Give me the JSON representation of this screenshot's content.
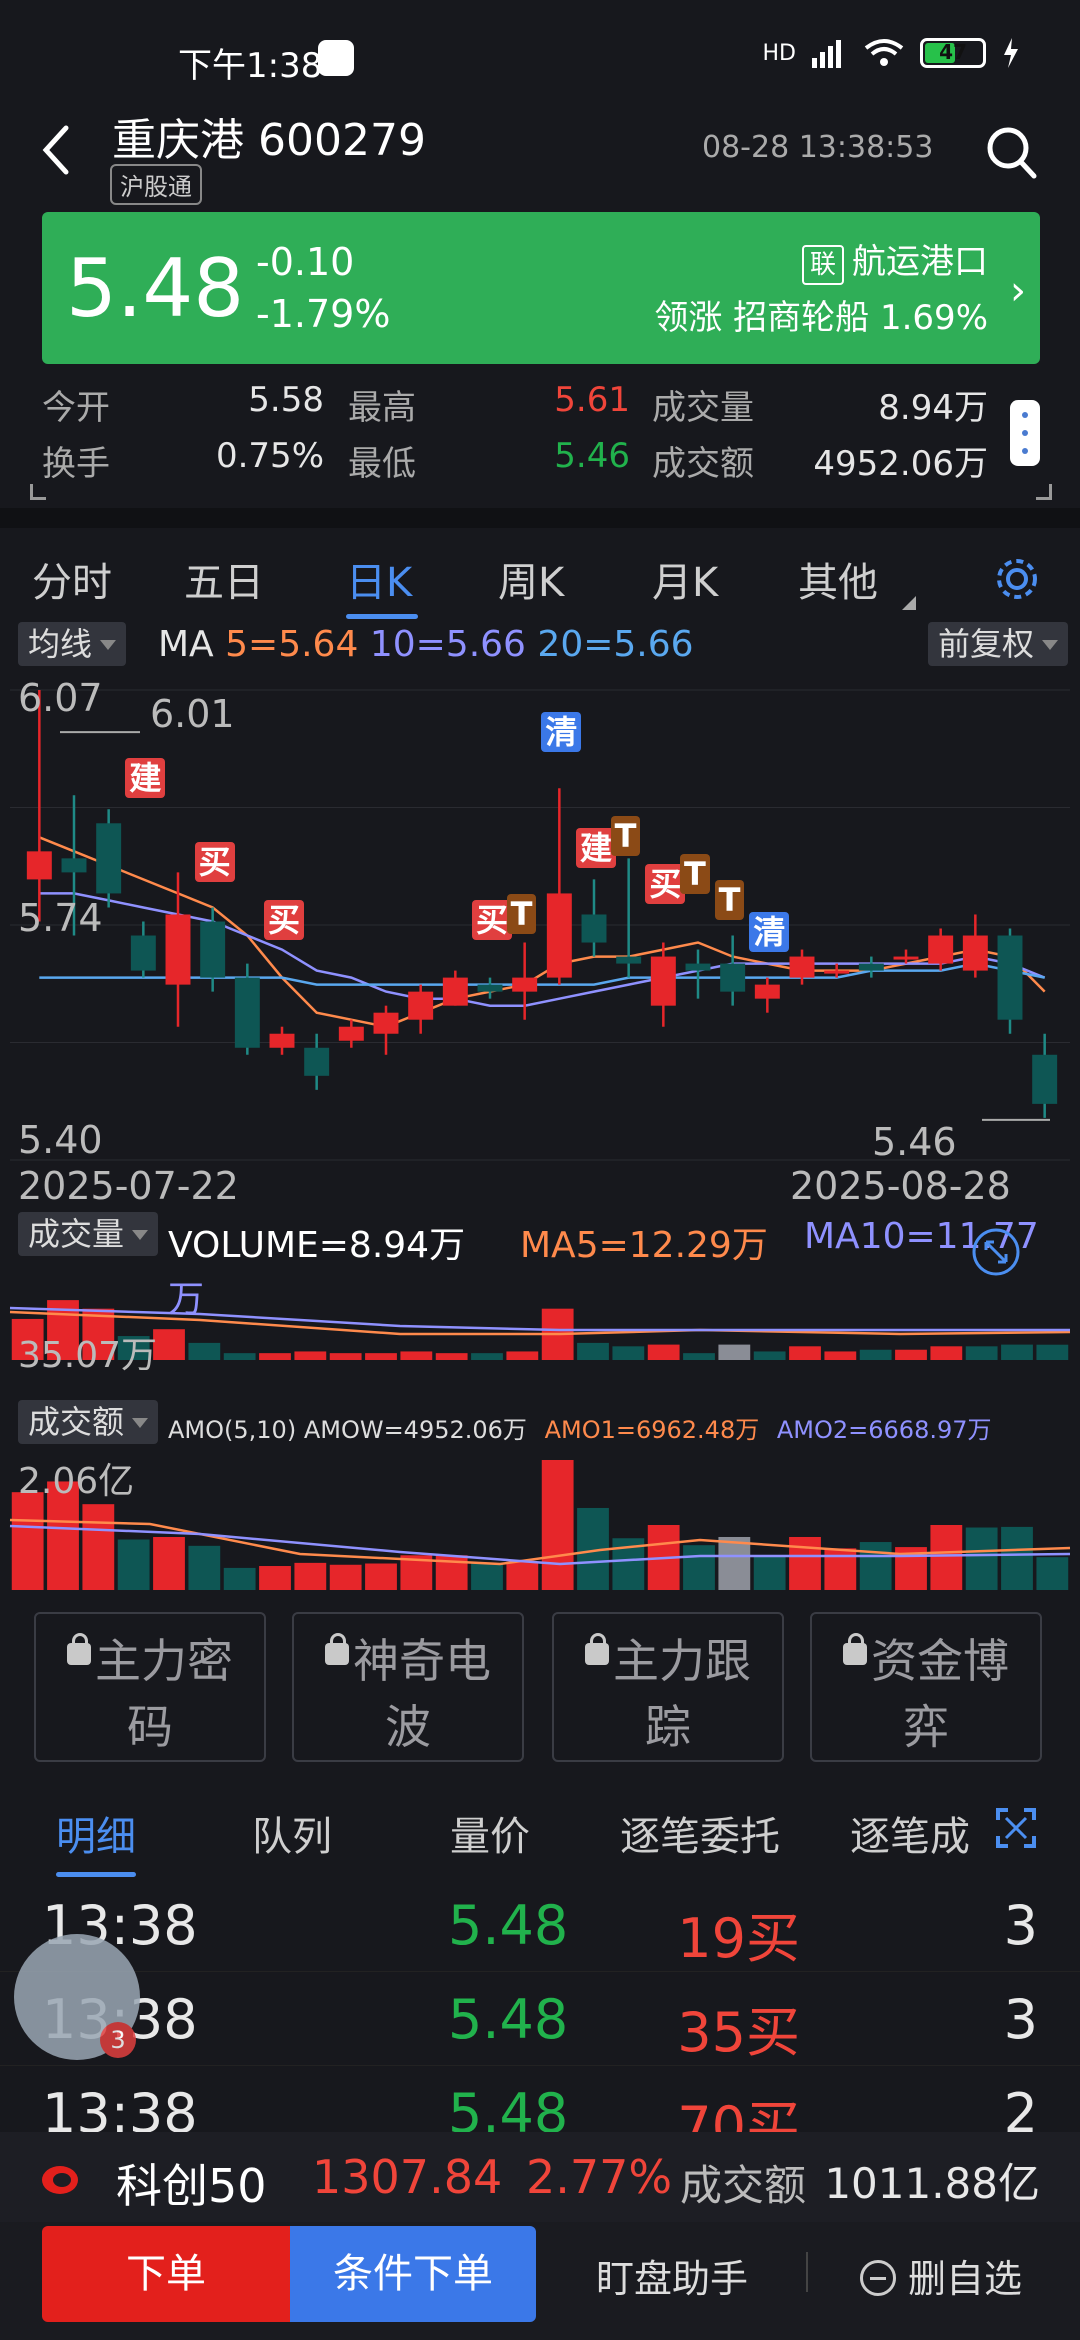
{
  "status": {
    "time": "下午1:38",
    "battery": "47",
    "network": "HD"
  },
  "header": {
    "stock_name": "重庆港 600279",
    "badge": "沪股通",
    "datetime": "08-28 13:38:53"
  },
  "banner": {
    "price": "5.48",
    "change": "-0.10",
    "change_pct": "-1.79%",
    "sector_tag": "联",
    "sector": "航运港口",
    "leader": "领涨 招商轮船 1.69%"
  },
  "stats": [
    {
      "label": "今开",
      "value": "5.58",
      "color": "#e6e6e6"
    },
    {
      "label": "最高",
      "value": "5.61",
      "color": "#f0453a"
    },
    {
      "label": "成交量",
      "value": "8.94万",
      "color": "#e6e6e6"
    },
    {
      "label": "换手",
      "value": "0.75%",
      "color": "#e6e6e6"
    },
    {
      "label": "最低",
      "value": "5.46",
      "color": "#21b24c"
    },
    {
      "label": "成交额",
      "value": "4952.06万",
      "color": "#e6e6e6"
    }
  ],
  "tabs": [
    "分时",
    "五日",
    "日K",
    "周K",
    "月K",
    "其他"
  ],
  "active_tab": "日K",
  "kline": {
    "indicator_pill": "均线",
    "adjust_pill": "前复权",
    "ma_prefix": "MA",
    "ma5": "5=5.64",
    "ma10": "10=5.66",
    "ma20": "20=5.66",
    "axis_high": "6.07",
    "axis_mid": "5.74",
    "axis_low": "5.40",
    "peak_label": "6.01",
    "trough_label": "5.46",
    "date_start": "2025-07-22",
    "date_end": "2025-08-28",
    "signals": [
      "建",
      "买",
      "买",
      "清",
      "建",
      "买",
      "T",
      "T",
      "T",
      "买",
      "T",
      "清"
    ]
  },
  "volume": {
    "pill": "成交量",
    "label": "VOLUME=8.94万",
    "ma5": "MA5=12.29万",
    "ma10": "MA10=11.77",
    "ma10_unit": "万",
    "max": "35.07万"
  },
  "amount": {
    "pill": "成交额",
    "label": "AMO(5,10)",
    "amow": "AMOW=4952.06万",
    "amo1": "AMO1=6962.48万",
    "amo2": "AMO2=6668.97万",
    "max": "2.06亿"
  },
  "tools": [
    {
      "line1": "主力密",
      "line2": "码"
    },
    {
      "line1": "神奇电",
      "line2": "波"
    },
    {
      "line1": "主力跟",
      "line2": "踪"
    },
    {
      "line1": "资金博",
      "line2": "弈"
    }
  ],
  "detail_tabs": [
    "明细",
    "队列",
    "量价",
    "逐笔委托",
    "逐笔成"
  ],
  "trades": [
    {
      "time": "13:38",
      "price": "5.48",
      "qty": "19买",
      "count": "3"
    },
    {
      "time": "13:38",
      "price": "5.48",
      "qty": "35买",
      "count": "3"
    },
    {
      "time": "13:38",
      "price": "5.48",
      "qty": "70买",
      "count": "2"
    }
  ],
  "avatar_badge": "3",
  "ticker": {
    "name": "科创50",
    "value": "1307.84",
    "pct": "2.77%",
    "amount_label": "成交额",
    "amount": "1011.88亿"
  },
  "bottom": {
    "order": "下单",
    "conditional": "条件下单",
    "helper": "盯盘助手",
    "remove": "删自选"
  },
  "colors": {
    "up": "#e6262a",
    "down": "#0e5654",
    "accent": "#4b8ef0",
    "banner": "#2fae57"
  },
  "chart_data": [
    {
      "type": "candlestick",
      "title": "日K",
      "xlabel": "",
      "ylabel": "",
      "x_range": [
        "2025-07-22",
        "2025-08-28"
      ],
      "ylim": [
        5.4,
        6.07
      ],
      "candles": [
        {
          "o": 5.8,
          "c": 5.84,
          "h": 6.07,
          "l": 5.74
        },
        {
          "o": 5.83,
          "c": 5.81,
          "h": 5.92,
          "l": 5.72
        },
        {
          "o": 5.88,
          "c": 5.78,
          "h": 5.9,
          "l": 5.76
        },
        {
          "o": 5.72,
          "c": 5.67,
          "h": 5.74,
          "l": 5.66
        },
        {
          "o": 5.65,
          "c": 5.75,
          "h": 5.81,
          "l": 5.59
        },
        {
          "o": 5.74,
          "c": 5.66,
          "h": 5.76,
          "l": 5.64
        },
        {
          "o": 5.66,
          "c": 5.56,
          "h": 5.68,
          "l": 5.55
        },
        {
          "o": 5.56,
          "c": 5.58,
          "h": 5.59,
          "l": 5.55
        },
        {
          "o": 5.56,
          "c": 5.52,
          "h": 5.58,
          "l": 5.5
        },
        {
          "o": 5.57,
          "c": 5.59,
          "h": 5.6,
          "l": 5.56
        },
        {
          "o": 5.58,
          "c": 5.61,
          "h": 5.62,
          "l": 5.55
        },
        {
          "o": 5.6,
          "c": 5.64,
          "h": 5.65,
          "l": 5.58
        },
        {
          "o": 5.62,
          "c": 5.66,
          "h": 5.67,
          "l": 5.62
        },
        {
          "o": 5.65,
          "c": 5.64,
          "h": 5.66,
          "l": 5.63
        },
        {
          "o": 5.64,
          "c": 5.66,
          "h": 5.71,
          "l": 5.6
        },
        {
          "o": 5.66,
          "c": 5.78,
          "h": 5.93,
          "l": 5.65
        },
        {
          "o": 5.75,
          "c": 5.71,
          "h": 5.8,
          "l": 5.69
        },
        {
          "o": 5.69,
          "c": 5.68,
          "h": 5.83,
          "l": 5.66
        },
        {
          "o": 5.62,
          "c": 5.69,
          "h": 5.71,
          "l": 5.59
        },
        {
          "o": 5.68,
          "c": 5.67,
          "h": 5.7,
          "l": 5.63
        },
        {
          "o": 5.68,
          "c": 5.64,
          "h": 5.72,
          "l": 5.62
        },
        {
          "o": 5.63,
          "c": 5.65,
          "h": 5.66,
          "l": 5.61
        },
        {
          "o": 5.66,
          "c": 5.69,
          "h": 5.7,
          "l": 5.65
        },
        {
          "o": 5.67,
          "c": 5.67,
          "h": 5.68,
          "l": 5.66
        },
        {
          "o": 5.68,
          "c": 5.67,
          "h": 5.69,
          "l": 5.66
        },
        {
          "o": 5.69,
          "c": 5.69,
          "h": 5.7,
          "l": 5.68
        },
        {
          "o": 5.68,
          "c": 5.72,
          "h": 5.73,
          "l": 5.67
        },
        {
          "o": 5.67,
          "c": 5.72,
          "h": 5.75,
          "l": 5.66
        },
        {
          "o": 5.72,
          "c": 5.6,
          "h": 5.73,
          "l": 5.58
        },
        {
          "o": 5.55,
          "c": 5.48,
          "h": 5.58,
          "l": 5.46
        }
      ],
      "ma_series": [
        {
          "name": "MA5",
          "values": [
            5.86,
            5.84,
            5.82,
            5.8,
            5.78,
            5.76,
            5.72,
            5.66,
            5.61,
            5.6,
            5.59,
            5.61,
            5.63,
            5.64,
            5.65,
            5.68,
            5.69,
            5.69,
            5.7,
            5.71,
            5.69,
            5.68,
            5.67,
            5.67,
            5.67,
            5.68,
            5.69,
            5.7,
            5.69,
            5.64
          ]
        },
        {
          "name": "MA10",
          "values": [
            5.78,
            5.78,
            5.77,
            5.76,
            5.75,
            5.74,
            5.72,
            5.7,
            5.67,
            5.66,
            5.64,
            5.63,
            5.63,
            5.62,
            5.62,
            5.63,
            5.64,
            5.65,
            5.66,
            5.67,
            5.68,
            5.68,
            5.68,
            5.68,
            5.68,
            5.68,
            5.68,
            5.69,
            5.68,
            5.66
          ]
        },
        {
          "name": "MA20",
          "values": [
            5.66,
            5.66,
            5.66,
            5.66,
            5.66,
            5.66,
            5.66,
            5.66,
            5.65,
            5.65,
            5.65,
            5.65,
            5.65,
            5.65,
            5.65,
            5.65,
            5.65,
            5.66,
            5.66,
            5.66,
            5.66,
            5.66,
            5.66,
            5.66,
            5.67,
            5.67,
            5.67,
            5.68,
            5.67,
            5.66
          ]
        }
      ]
    },
    {
      "type": "bar",
      "title": "成交量",
      "xlabel": "",
      "ylabel": "",
      "ylim": [
        0,
        35.07
      ],
      "values": [
        24,
        35,
        30,
        14,
        18,
        10,
        4,
        4,
        5,
        4,
        4,
        5,
        4,
        4,
        5,
        30,
        10,
        8,
        9,
        4,
        9,
        5,
        8,
        5,
        6,
        6,
        8,
        8,
        9,
        8.94
      ],
      "up_flags": [
        1,
        1,
        1,
        0,
        1,
        0,
        0,
        1,
        1,
        1,
        1,
        1,
        1,
        0,
        1,
        1,
        0,
        0,
        1,
        0,
        1,
        0,
        1,
        1,
        0,
        1,
        1,
        0,
        0,
        0
      ]
    },
    {
      "type": "bar",
      "title": "成交额",
      "xlabel": "",
      "ylabel": "",
      "ylim": [
        0,
        2.06
      ],
      "values": [
        1.55,
        1.72,
        1.36,
        0.8,
        0.84,
        0.7,
        0.35,
        0.38,
        0.43,
        0.4,
        0.42,
        0.55,
        0.55,
        0.42,
        0.45,
        2.06,
        1.3,
        0.82,
        1.03,
        0.71,
        0.84,
        0.55,
        0.84,
        0.66,
        0.76,
        0.68,
        1.03,
        0.99,
        1.0,
        0.52
      ],
      "up_flags": [
        1,
        1,
        1,
        0,
        1,
        0,
        0,
        1,
        1,
        1,
        1,
        1,
        1,
        0,
        1,
        1,
        0,
        0,
        1,
        0,
        1,
        0,
        1,
        1,
        0,
        1,
        1,
        0,
        0,
        0
      ]
    }
  ]
}
